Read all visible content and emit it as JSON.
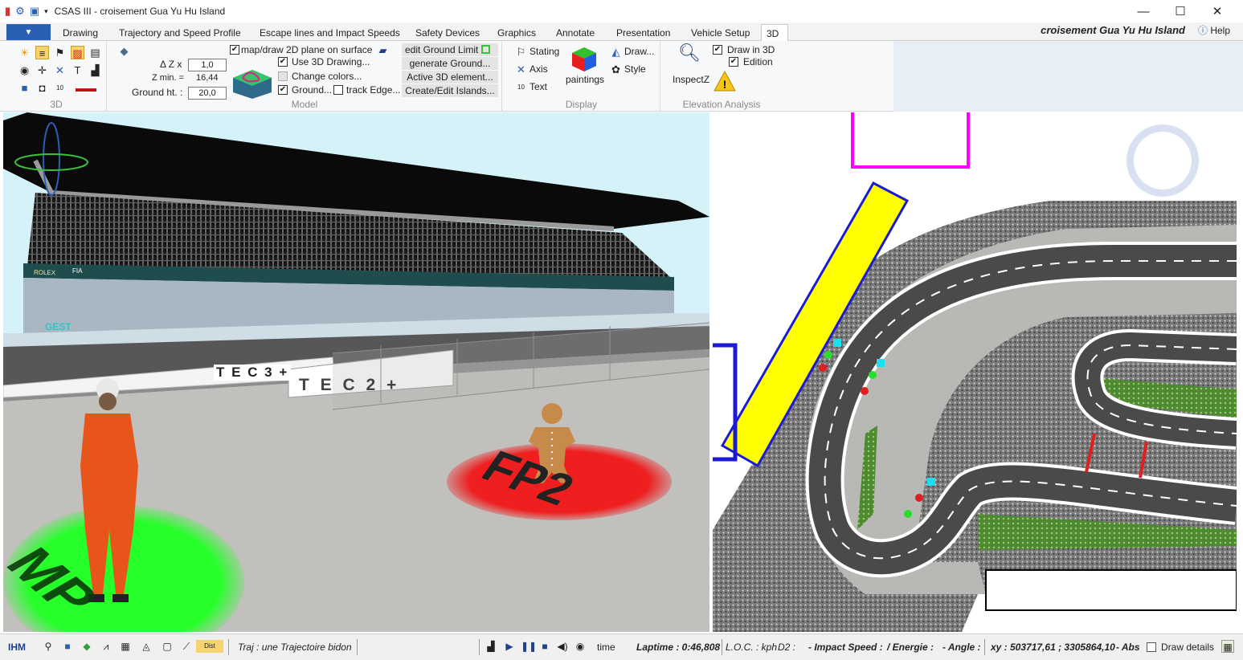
{
  "window": {
    "title": "CSAS III - croisement Gua Yu Hu Island",
    "minimize": "—",
    "maximize": "☐",
    "close": "✕"
  },
  "tabs": [
    "Drawing",
    "Trajectory and Speed Profile",
    "Escape lines and Impact Speeds",
    "Safety Devices",
    "Graphics",
    "Annotate",
    "Presentation",
    "Vehicle Setup",
    "3D"
  ],
  "doc_title": "croisement Gua Yu Hu Island",
  "help_label": "Help",
  "ribbon": {
    "group_3d": "3D",
    "model": {
      "group_label": "Model",
      "dz_label": "Δ Z x",
      "dz_value": "1,0",
      "zmin_label": "Z min. =",
      "zmin_value": "16,44",
      "ground_label": "Ground ht. :",
      "ground_value": "20,0",
      "map_draw": "map/draw 2D plane on surface",
      "use3d": "Use 3D Drawing...",
      "change_colors": "Change colors...",
      "ground_chk": "Ground...",
      "track_edge": "track Edge...",
      "edit_ground_limit": "edit Ground Limit",
      "generate_ground": "generate Ground...",
      "active_3d": "Active 3D element...",
      "create_islands": "Create/Edit Islands..."
    },
    "display": {
      "group_label": "Display",
      "stating": "Stating",
      "axis": "Axis",
      "text": "Text",
      "paintings": "paintings",
      "draw": "Draw...",
      "style": "Style"
    },
    "elevation": {
      "group_label": "Elevation Analysis",
      "inspectz": "InspectZ",
      "draw3d": "Draw in 3D",
      "edition": "Edition"
    }
  },
  "status": {
    "ihm": "IHM",
    "traj": "Traj :  une Trajectoire bidon",
    "time": "time",
    "laptime": "Laptime : 0:46,808",
    "loc": "L.O.C. : kph",
    "d2": "D2 :",
    "impact": "- Impact Speed :",
    "energie": "/ Energie :",
    "angle": "- Angle :",
    "xy": "xy : 503717,61 ; 3305864,10",
    "abs": "- Abs",
    "draw_details": "Draw details"
  },
  "scene3d": {
    "banner_rolex": "ROLEX",
    "banner_fia": "FIA",
    "sign_tec3": "T E C 3 +",
    "sign_tec2": "T E C 2 +",
    "badge_gest": "GEST",
    "marker_mp": "MP",
    "marker_fp2": "FP2"
  },
  "colors": {
    "accent_blue": "#2b5fb3",
    "marker_green": "#27ff2b",
    "marker_red": "#ef1f1f",
    "barrier_yellow": "#ffff00",
    "bay_magenta": "#ff00ff"
  }
}
